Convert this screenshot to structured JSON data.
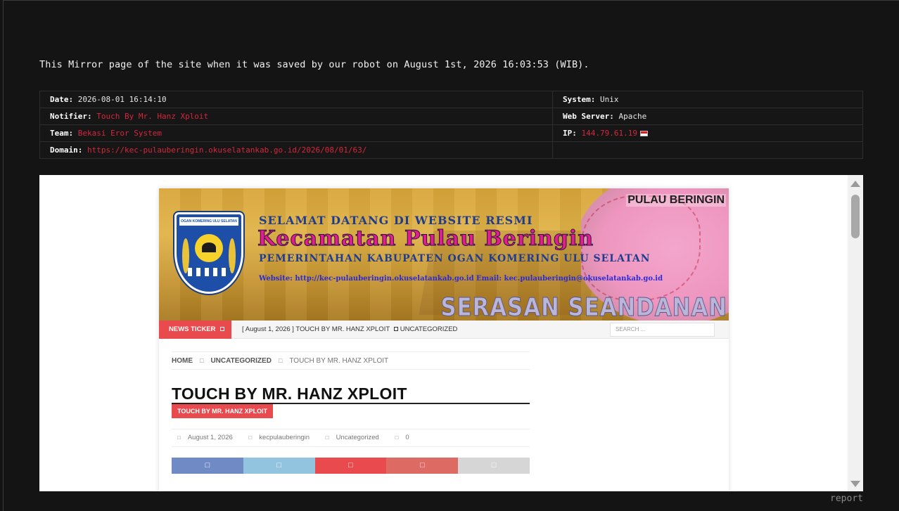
{
  "intro_text": "This Mirror page of the site when it was saved by our robot on August 1st, 2026 16:03:53 (WIB).",
  "meta": {
    "date_label": "Date:",
    "date_value": "2026-08-01 16:14:10",
    "notifier_label": "Notifier:",
    "notifier_value": "Touch By Mr. Hanz Xploit",
    "team_label": "Team:",
    "team_value": "Bekasi Eror System",
    "domain_label": "Domain:",
    "domain_value": "https://kec-pulauberingin.okuselatankab.go.id/2026/08/01/63/",
    "system_label": "System:",
    "system_value": "Unix",
    "webserver_label": "Web Server:",
    "webserver_value": "Apache",
    "ip_label": "IP:",
    "ip_value": "144.79.61.19",
    "flag_colors": [
      "#e01c24",
      "#ffffff"
    ]
  },
  "site": {
    "banner": {
      "logo_band": "OGAN KOMERING ULU SELATAN",
      "line1": "SELAMAT DATANG DI WEBSITE RESMI",
      "line2": "Kecamatan Pulau Beringin",
      "line3": "PEMERINTAHAN KABUPATEN OGAN KOMERING ULU SELATAN",
      "line4": "Website: http://kec-pulauberingin.okuselatankab.go.id  Email: kec.pulauberingin@okuselatankab.go.id",
      "region_tag": "PULAU BERINGIN",
      "motto": "SERASAN SEANDANAN"
    },
    "ticker": {
      "label": "NEWS TICKER",
      "text": "[ August 1, 2026 ]  TOUCH BY MR. HANZ XPLOIT",
      "category": "UNCATEGORIZED",
      "search_placeholder": "SEARCH ..."
    },
    "breadcrumb": {
      "home": "HOME",
      "category": "UNCATEGORIZED",
      "current": "TOUCH BY MR. HANZ XPLOIT"
    },
    "post": {
      "title": "TOUCH BY MR. HANZ XPLOIT",
      "tag": "TOUCH BY MR. HANZ XPLOIT",
      "date": "August 1, 2026",
      "author": "kecpulauberingin",
      "category": "Uncategorized",
      "comments": "0"
    },
    "share_colors": [
      "#6f8ac4",
      "#92c3df",
      "#e94a4d",
      "#de6b63",
      "#d6d6d6"
    ],
    "share_icon": "□"
  },
  "report_label": "report"
}
